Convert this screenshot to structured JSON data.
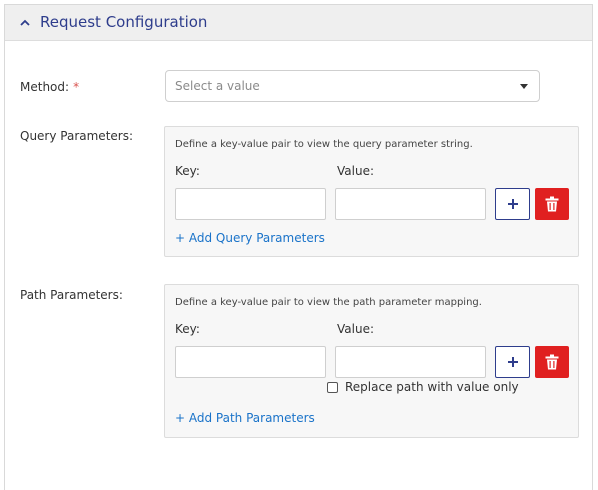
{
  "panel": {
    "title": "Request Configuration",
    "collapse_icon": "chevron-up-icon"
  },
  "method": {
    "label": "Method:",
    "required_mark": "*",
    "placeholder": "Select a value",
    "dropdown_icon": "caret-down-icon"
  },
  "query": {
    "label": "Query Parameters:",
    "hint": "Define a key-value pair to view the query parameter string.",
    "key_label": "Key:",
    "value_label": "Value:",
    "key_value": "",
    "value_value": "",
    "add_icon": "plus-icon",
    "delete_icon": "trash-icon",
    "add_link": "+ Add Query Parameters"
  },
  "path": {
    "label": "Path Parameters:",
    "hint": "Define a key-value pair to view the path parameter mapping.",
    "key_label": "Key:",
    "value_label": "Value:",
    "key_value": "",
    "value_value": "",
    "add_icon": "plus-icon",
    "delete_icon": "trash-icon",
    "checkbox_label": "Replace path with value only",
    "checkbox_checked": false,
    "add_link": "+ Add Path Parameters"
  },
  "colors": {
    "accent": "#2e3d8c",
    "link": "#1a73c9",
    "danger": "#e02020",
    "required": "#d9534f",
    "header_bg": "#efefef",
    "box_bg": "#f7f7f7"
  }
}
